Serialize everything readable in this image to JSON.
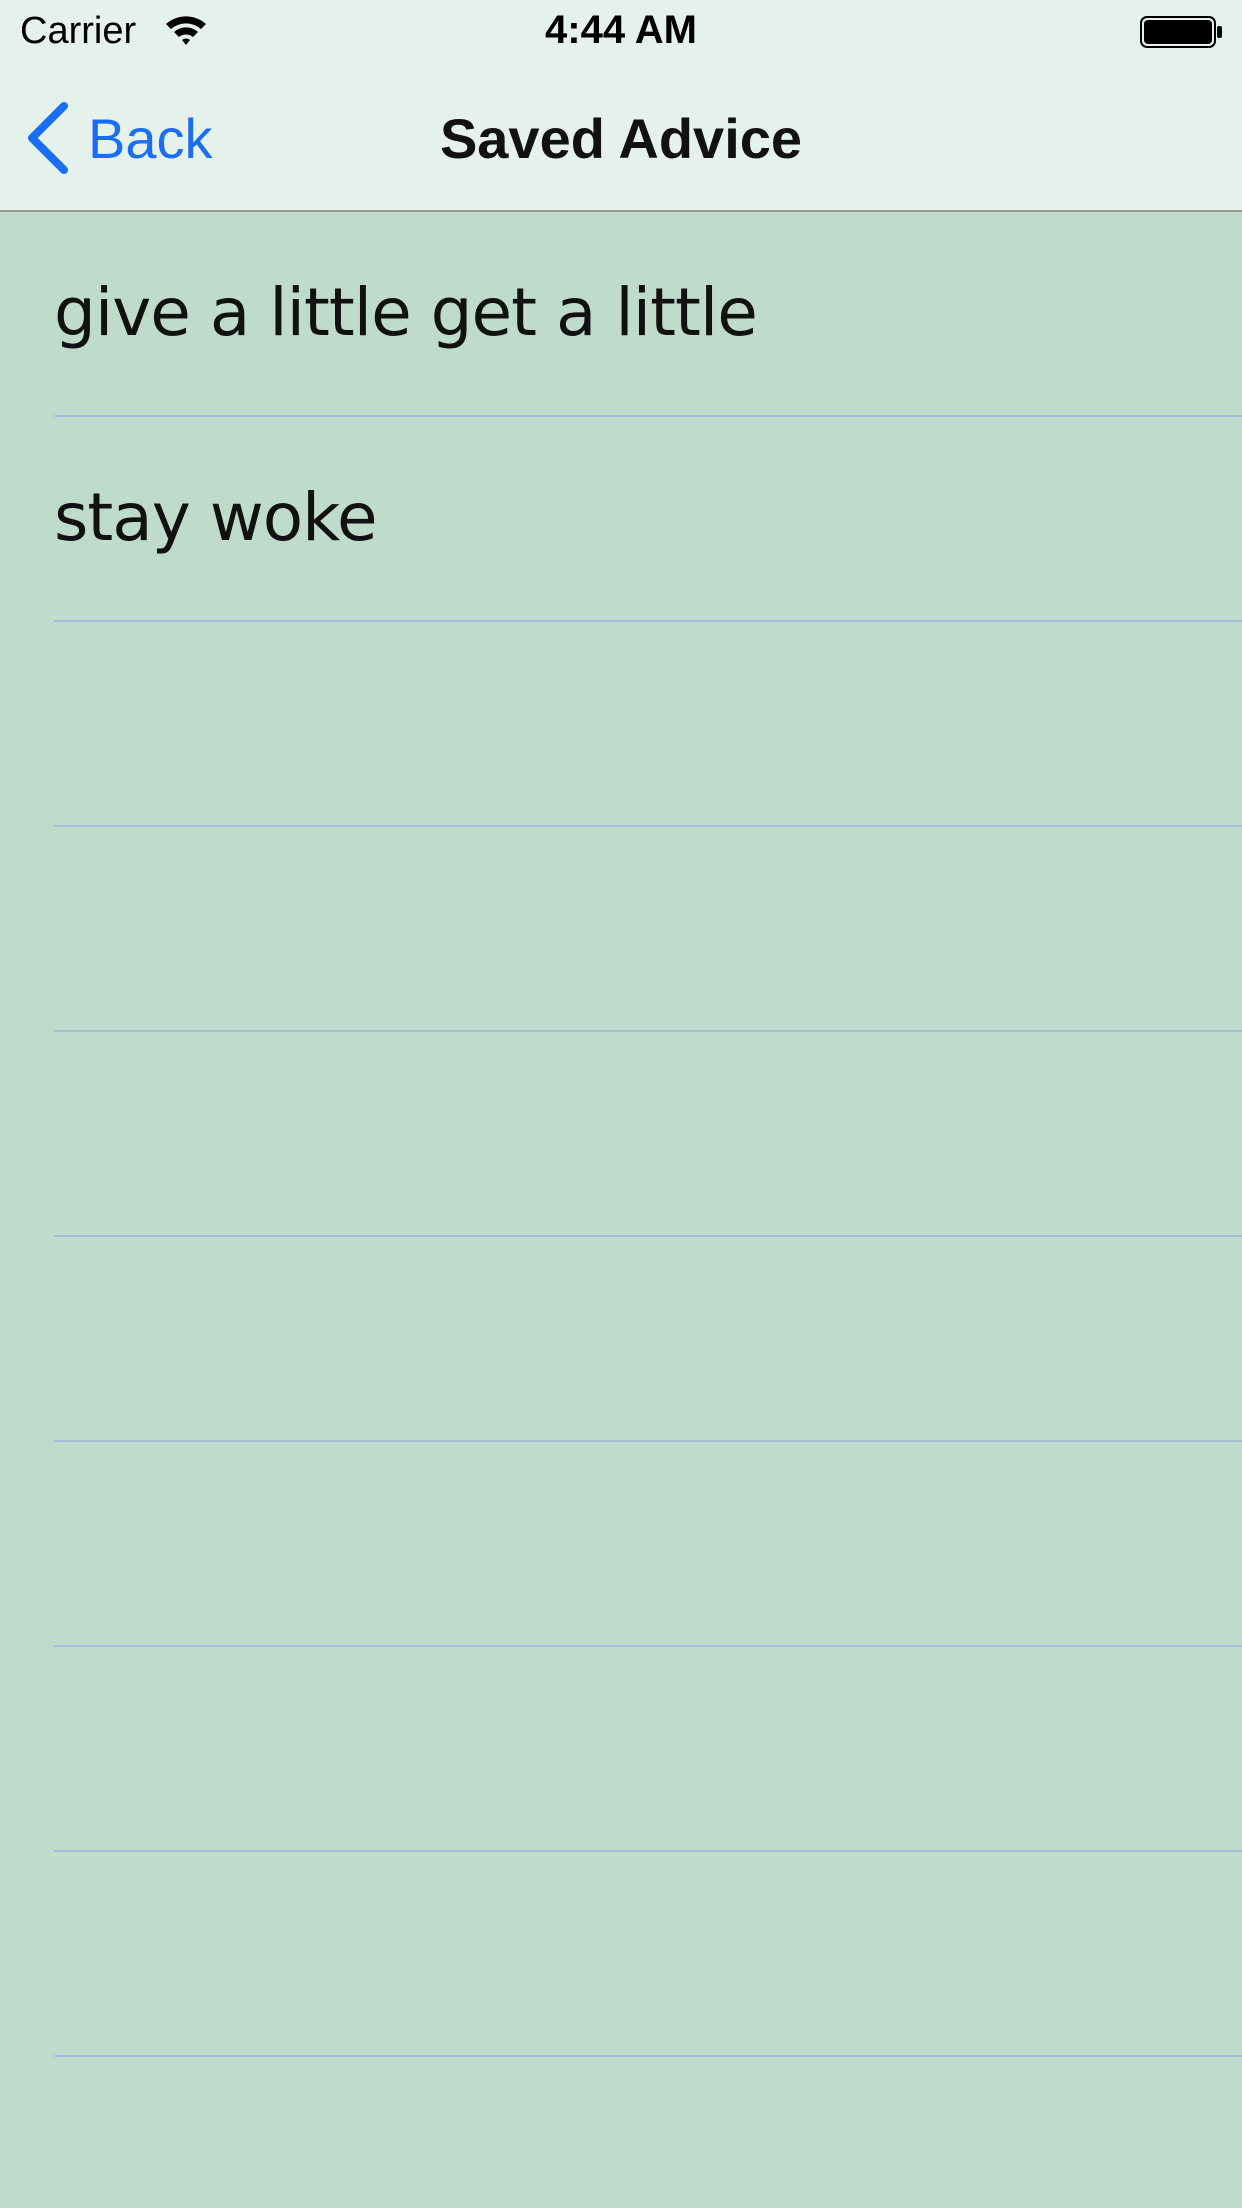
{
  "status_bar": {
    "carrier": "Carrier",
    "time": "4:44 AM"
  },
  "nav": {
    "back_label": "Back",
    "title": "Saved Advice"
  },
  "colors": {
    "background": "#bfdbcc",
    "bar": "#e5f2ec",
    "accent": "#1a6ef5",
    "separator": "#a4bedb"
  },
  "list": {
    "items": [
      {
        "text": "give a little get a little"
      },
      {
        "text": "stay woke"
      },
      {
        "text": ""
      },
      {
        "text": ""
      },
      {
        "text": ""
      },
      {
        "text": ""
      },
      {
        "text": ""
      },
      {
        "text": ""
      },
      {
        "text": ""
      }
    ]
  }
}
